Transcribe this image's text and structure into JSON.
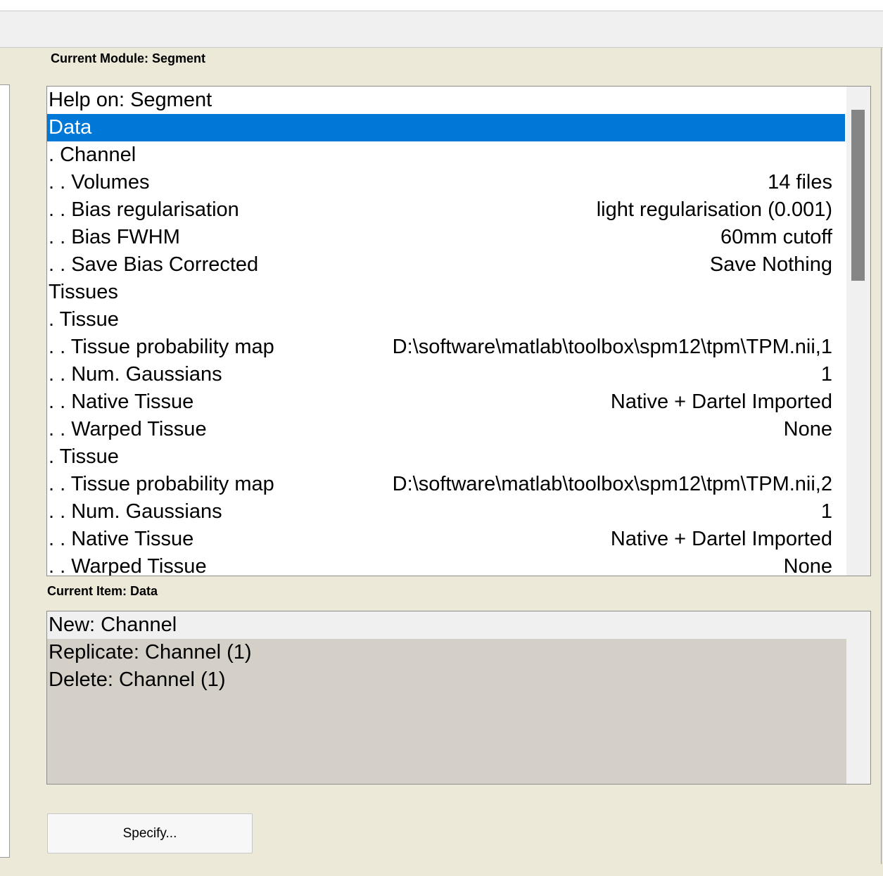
{
  "module": {
    "label": "Current Module: Segment"
  },
  "tree": {
    "items": [
      {
        "label": "Help on: Segment",
        "value": ""
      },
      {
        "label": "Data",
        "value": "",
        "selected": true
      },
      {
        "label": ". Channel",
        "value": ""
      },
      {
        "label": ". . Volumes",
        "value": "14 files"
      },
      {
        "label": ". . Bias regularisation",
        "value": "light regularisation (0.001)"
      },
      {
        "label": ". . Bias FWHM",
        "value": "60mm cutoff"
      },
      {
        "label": ". . Save Bias Corrected",
        "value": "Save Nothing"
      },
      {
        "label": "Tissues",
        "value": ""
      },
      {
        "label": ". Tissue",
        "value": ""
      },
      {
        "label": ". . Tissue probability map",
        "value": "D:\\software\\matlab\\toolbox\\spm12\\tpm\\TPM.nii,1"
      },
      {
        "label": ". . Num. Gaussians",
        "value": "1"
      },
      {
        "label": ". . Native Tissue",
        "value": "Native + Dartel Imported"
      },
      {
        "label": ". . Warped Tissue",
        "value": "None"
      },
      {
        "label": ". Tissue",
        "value": ""
      },
      {
        "label": ". . Tissue probability map",
        "value": "D:\\software\\matlab\\toolbox\\spm12\\tpm\\TPM.nii,2"
      },
      {
        "label": ". . Num. Gaussians",
        "value": "1"
      },
      {
        "label": ". . Native Tissue",
        "value": "Native + Dartel Imported"
      },
      {
        "label": ". . Warped Tissue",
        "value": "None"
      }
    ]
  },
  "current_item": {
    "label": "Current Item: Data",
    "options": [
      {
        "label": "New: Channel",
        "highlighted": true
      },
      {
        "label": "Replicate: Channel (1)",
        "highlighted": false
      },
      {
        "label": "Delete: Channel (1)",
        "highlighted": false
      }
    ]
  },
  "actions": {
    "specify_label": "Specify..."
  },
  "colors": {
    "selection": "#0078d7",
    "options_background": "#d4d0c8",
    "window_background": "#ece9d8"
  }
}
